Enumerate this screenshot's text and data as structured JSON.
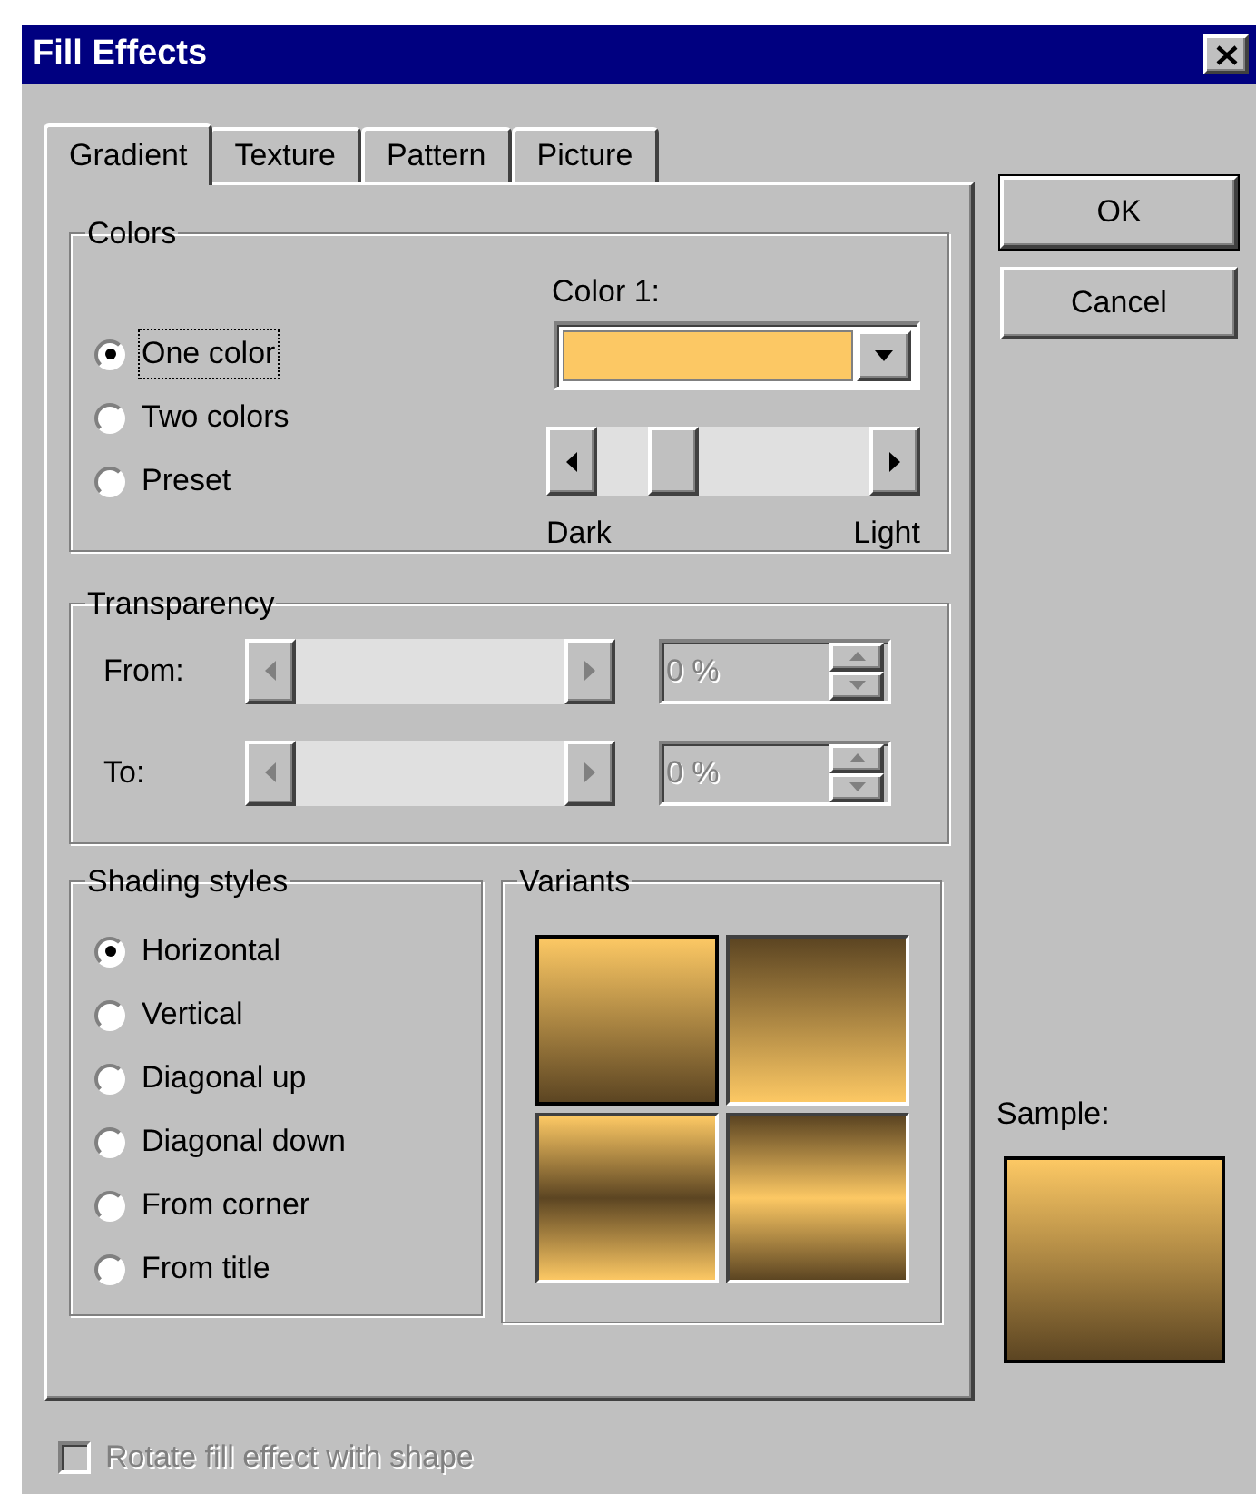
{
  "window": {
    "title": "Fill Effects"
  },
  "tabs": [
    {
      "label": "Gradient",
      "selected": true
    },
    {
      "label": "Texture",
      "selected": false
    },
    {
      "label": "Pattern",
      "selected": false
    },
    {
      "label": "Picture",
      "selected": false
    }
  ],
  "colors": {
    "title": "Colors",
    "options": [
      {
        "label": "One color",
        "selected": true
      },
      {
        "label": "Two colors",
        "selected": false
      },
      {
        "label": "Preset",
        "selected": false
      }
    ],
    "color_1": {
      "label": "Color 1:",
      "color": "#fcc864"
    },
    "shade": {
      "level": 0.23,
      "left_label": "Dark",
      "right_label": "Light"
    }
  },
  "transparency": {
    "title": "Transparency",
    "disabled": true,
    "rows": [
      {
        "label": "From:",
        "value": "0 %"
      },
      {
        "label": "To:",
        "value": "0 %"
      }
    ]
  },
  "shading_styles": {
    "title": "Shading styles",
    "options": [
      {
        "label": "Horizontal",
        "selected": true
      },
      {
        "label": "Vertical",
        "selected": false
      },
      {
        "label": "Diagonal up",
        "selected": false
      },
      {
        "label": "Diagonal down",
        "selected": false
      },
      {
        "label": "From corner",
        "selected": false
      },
      {
        "label": "From title",
        "selected": false
      }
    ]
  },
  "variants": {
    "title": "Variants",
    "items": [
      {
        "kind": "light-to-dark",
        "selected": true
      },
      {
        "kind": "dark-to-light",
        "selected": false
      },
      {
        "kind": "dark-middle",
        "selected": false
      },
      {
        "kind": "light-middle",
        "selected": false
      }
    ]
  },
  "buttons": [
    {
      "label": "OK",
      "default": true
    },
    {
      "label": "Cancel",
      "default": false
    }
  ],
  "sample": {
    "label": "Sample:",
    "kind": "light-to-dark"
  },
  "rotate_checkbox": {
    "label": "Rotate fill effect with shape",
    "checked": false,
    "disabled": true
  }
}
